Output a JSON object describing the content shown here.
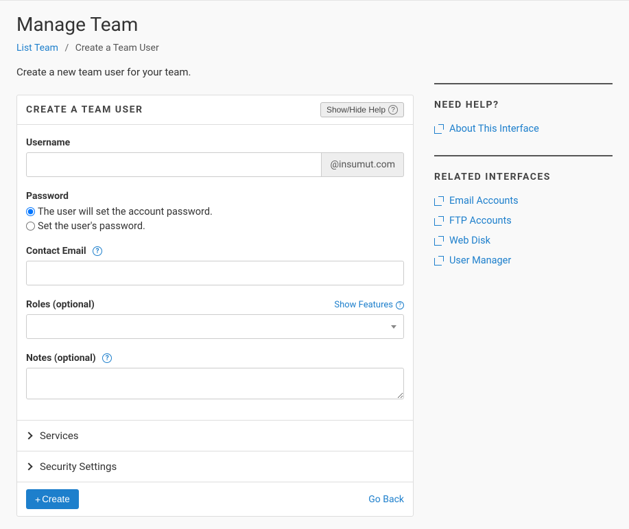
{
  "header": {
    "title": "Manage Team",
    "breadcrumb_link": "List Team",
    "breadcrumb_sep": "/",
    "breadcrumb_current": "Create a Team User",
    "intro": "Create a new team user for your team."
  },
  "panel": {
    "title": "CREATE A TEAM USER",
    "help_btn": "Show/Hide Help"
  },
  "form": {
    "username_label": "Username",
    "username_value": "",
    "domain_suffix": "@insumut.com",
    "password_label": "Password",
    "pw_option_user": "The user will set the account password.",
    "pw_option_admin": "Set the user's password.",
    "contact_label": "Contact Email",
    "contact_value": "",
    "roles_label": "Roles (optional)",
    "show_features": "Show Features",
    "roles_value": "",
    "notes_label": "Notes (optional)",
    "notes_value": ""
  },
  "accordion": {
    "services": "Services",
    "security": "Security Settings"
  },
  "footer": {
    "create": "Create",
    "go_back": "Go Back"
  },
  "sidebar": {
    "help_title": "NEED HELP?",
    "help_links": [
      "About This Interface"
    ],
    "related_title": "RELATED INTERFACES",
    "related_links": [
      "Email Accounts",
      "FTP Accounts",
      "Web Disk",
      "User Manager"
    ]
  }
}
